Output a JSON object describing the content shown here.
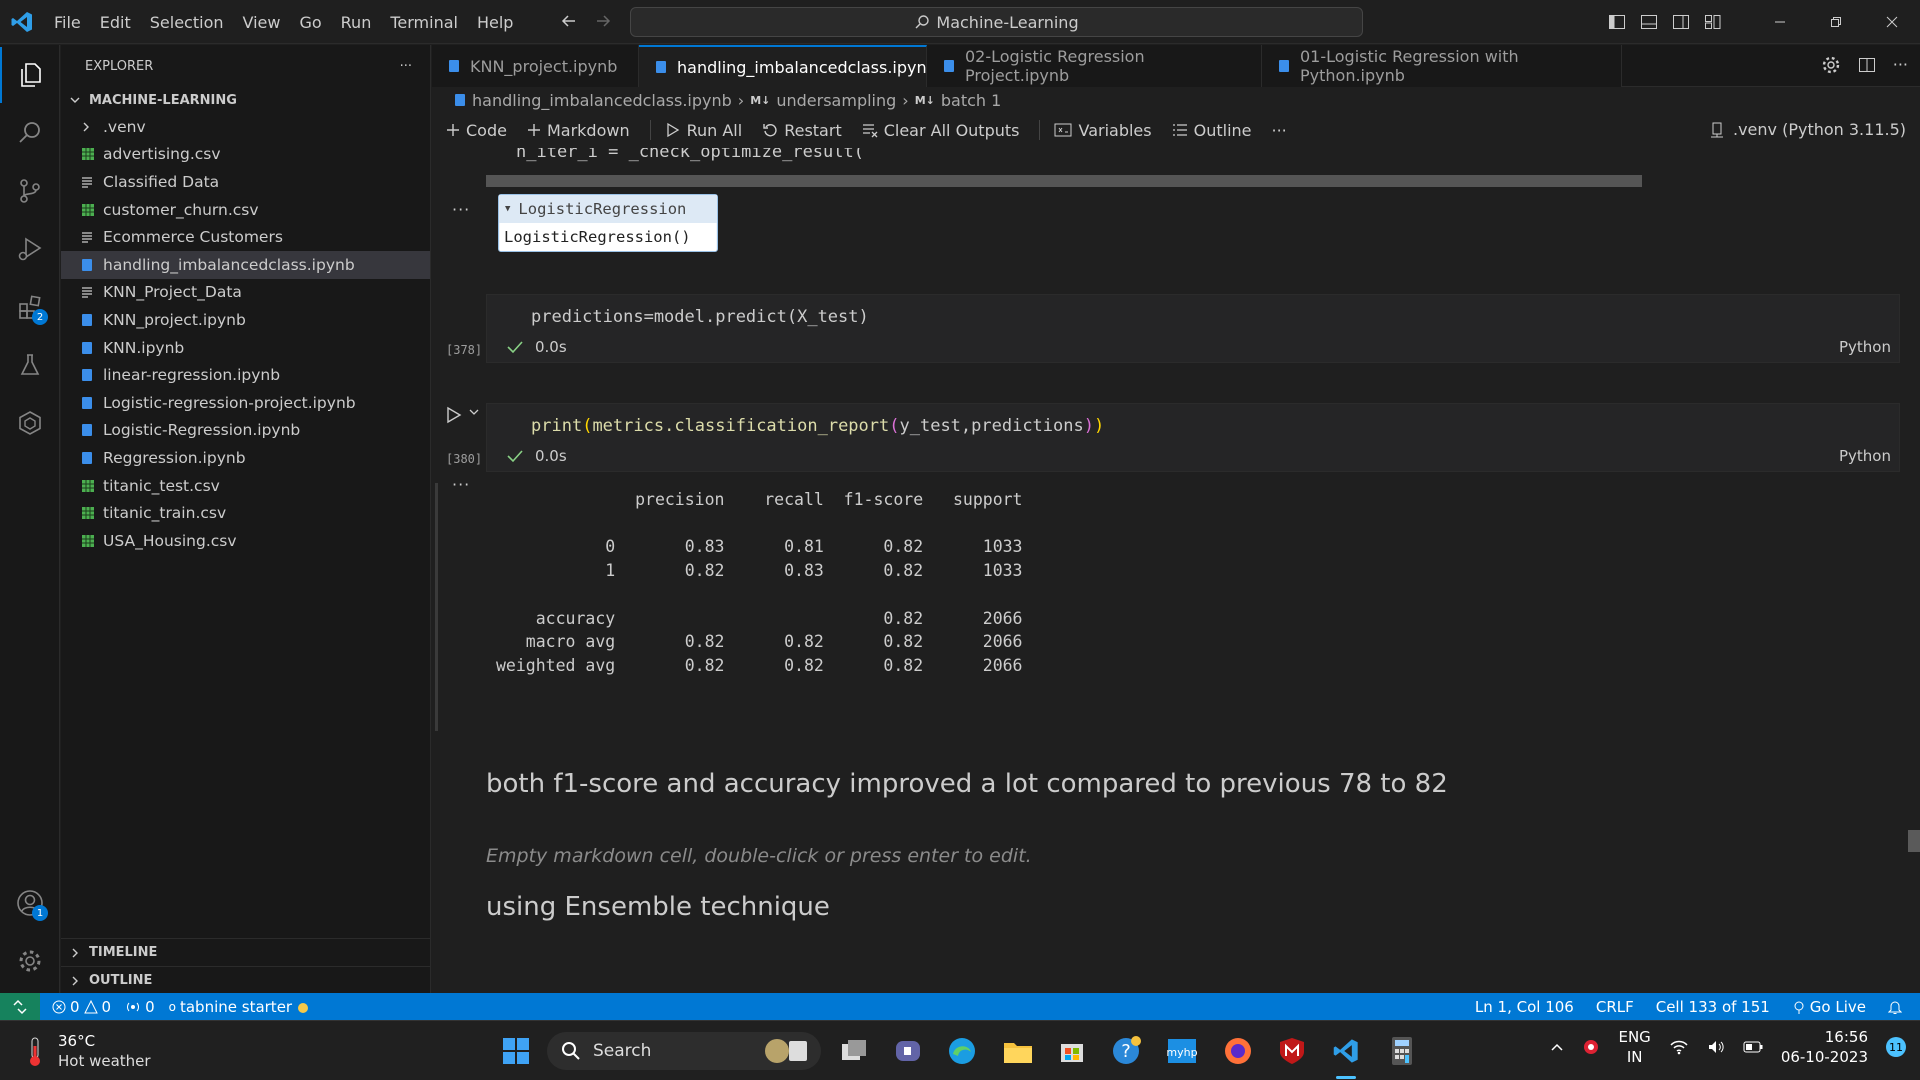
{
  "menu": [
    "File",
    "Edit",
    "Selection",
    "View",
    "Go",
    "Run",
    "Terminal",
    "Help"
  ],
  "command_center": "Machine-Learning",
  "explorer": {
    "title": "EXPLORER",
    "folder": "MACHINE-LEARNING",
    "files": [
      {
        "name": ".venv",
        "type": "folder"
      },
      {
        "name": "advertising.csv",
        "type": "csv"
      },
      {
        "name": "Classified Data",
        "type": "text"
      },
      {
        "name": "customer_churn.csv",
        "type": "csv"
      },
      {
        "name": "Ecommerce Customers",
        "type": "text"
      },
      {
        "name": "handling_imbalancedclass.ipynb",
        "type": "notebook"
      },
      {
        "name": "KNN_Project_Data",
        "type": "text"
      },
      {
        "name": "KNN_project.ipynb",
        "type": "notebook"
      },
      {
        "name": "KNN.ipynb",
        "type": "notebook"
      },
      {
        "name": "linear-regression.ipynb",
        "type": "notebook"
      },
      {
        "name": "Logistic-regression-project.ipynb",
        "type": "notebook"
      },
      {
        "name": "Logistic-Regression.ipynb",
        "type": "notebook"
      },
      {
        "name": "Reggression.ipynb",
        "type": "notebook"
      },
      {
        "name": "titanic_test.csv",
        "type": "csv"
      },
      {
        "name": "titanic_train.csv",
        "type": "csv"
      },
      {
        "name": "USA_Housing.csv",
        "type": "csv"
      }
    ],
    "timeline": "TIMELINE",
    "outline": "OUTLINE"
  },
  "activity_badges": {
    "extensions": "2",
    "accounts": "1"
  },
  "tabs": [
    {
      "label": "KNN_project.ipynb",
      "active": false
    },
    {
      "label": "handling_imbalancedclass.ipynb",
      "active": true
    },
    {
      "label": "02-Logistic Regression Project.ipynb",
      "active": false
    },
    {
      "label": "01-Logistic Regression with Python.ipynb",
      "active": false
    }
  ],
  "breadcrumb": {
    "file": "handling_imbalancedclass.ipynb",
    "md_tag": "M↓",
    "part1": "undersampling",
    "part2": "batch 1"
  },
  "toolbar": {
    "code": "Code",
    "markdown": "Markdown",
    "run_all": "Run All",
    "restart": "Restart",
    "clear": "Clear All Outputs",
    "variables": "Variables",
    "outline": "Outline",
    "kernel": ".venv (Python 3.11.5)"
  },
  "notebook": {
    "prev_line": "n_iter_i = _check_optimize_result(",
    "widget_title": "LogisticRegression",
    "widget_body": "LogisticRegression()",
    "cell1": {
      "code": "predictions=model.predict(X_test)",
      "exec": "[378]",
      "time": "0.0s",
      "lang": "Python"
    },
    "cell2": {
      "code_fn": "print",
      "code_inner": "metrics.classification_report",
      "code_args": "y_test,predictions",
      "exec": "[380]",
      "time": "0.0s",
      "lang": "Python"
    },
    "report": "              precision    recall  f1-score   support\n\n           0       0.83      0.81      0.82      1033\n           1       0.82      0.83      0.82      1033\n\n    accuracy                           0.82      2066\n   macro avg       0.82      0.82      0.82      2066\nweighted avg       0.82      0.82      0.82      2066",
    "md1": "both f1-score and accuracy improved a lot compared to previous 78 to 82",
    "md_empty": "Empty markdown cell, double-click or press enter to edit.",
    "md2": "using Ensemble technique"
  },
  "status": {
    "errors": "0",
    "warnings": "0",
    "ports": "0",
    "tabnine": "tabnine starter",
    "position": "Ln 1, Col 106",
    "eol": "CRLF",
    "cell": "Cell 133 of 151",
    "golive": "Go Live"
  },
  "taskbar": {
    "temp": "36°C",
    "weather": "Hot weather",
    "search": "Search",
    "lang1": "ENG",
    "lang2": "IN",
    "time": "16:56",
    "date": "06-10-2023",
    "notif": "11"
  }
}
